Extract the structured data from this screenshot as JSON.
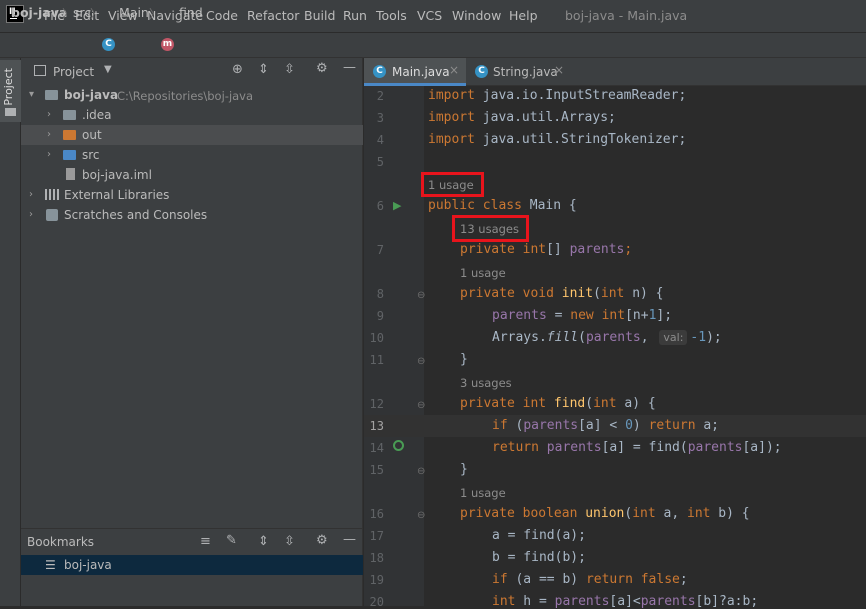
{
  "menubar": {
    "items": [
      "File",
      "Edit",
      "View",
      "Navigate",
      "Code",
      "Refactor",
      "Build",
      "Run",
      "Tools",
      "VCS",
      "Window",
      "Help"
    ],
    "title": "boj-java - Main.java"
  },
  "breadcrumb": {
    "project": "boj-java",
    "folder": "src",
    "class": "Main",
    "method": "find"
  },
  "stripe": {
    "project_label": "Project"
  },
  "project_panel": {
    "title": "Project",
    "root": {
      "name": "boj-java",
      "path": "C:\\Repositories\\boj-java"
    },
    "items": [
      ".idea",
      "out",
      "src",
      "boj-java.iml"
    ],
    "external_libraries": "External Libraries",
    "scratches": "Scratches and Consoles"
  },
  "bookmarks_panel": {
    "title": "Bookmarks",
    "items": [
      "boj-java"
    ]
  },
  "editor": {
    "tabs": [
      "Main.java",
      "String.java"
    ],
    "line_numbers": [
      "2",
      "3",
      "4",
      "5",
      "6",
      "7",
      "8",
      "9",
      "10",
      "11",
      "12",
      "13",
      "14",
      "15",
      "16",
      "17",
      "18",
      "19",
      "20"
    ],
    "hints": {
      "class_usage": "1 usage",
      "parents_usage": "13 usages",
      "init_usage": "1 usage",
      "find_usage": "3 usages",
      "union_usage": "1 usage",
      "param_val": "val:"
    },
    "code": {
      "l2_kw": "import",
      "l2_rest": " java.io.InputStreamReader;",
      "l3_kw": "import",
      "l3_rest": " java.util.Arrays;",
      "l4_kw": "import",
      "l4_rest": " java.util.StringTokenizer;",
      "l6_kw": "public class",
      "l6_rest": " Main {",
      "l7_kw": "private int",
      "l7_br": "[] ",
      "l7_fld": "parents",
      "l7_end": ";",
      "l8_kw": "private void",
      "l8_fn": " init",
      "l8_a": "(",
      "l8_kw2": "int",
      "l8_b": " n) {",
      "l9_fld": "parents",
      "l9_a": " = ",
      "l9_kw": "new int",
      "l9_b": "[n+",
      "l9_num": "1",
      "l9_c": "];",
      "l10_a": "Arrays.",
      "l10_fn": "fill",
      "l10_b": "(",
      "l10_fld": "parents",
      "l10_c": ", ",
      "l10_num": "-1",
      "l10_d": ");",
      "l11": "}",
      "l12_kw": "private int",
      "l12_fn": " find",
      "l12_a": "(",
      "l12_kw2": "int",
      "l12_b": " a) {",
      "l13_kw": "if",
      "l13_a": " (",
      "l13_fld": "parents",
      "l13_b": "[a] < ",
      "l13_num": "0",
      "l13_c": ") ",
      "l13_kw2": "return",
      "l13_d": " a;",
      "l14_kw": "return",
      "l14_sp": " ",
      "l14_fld": "parents",
      "l14_a": "[a] = find(",
      "l14_fld2": "parents",
      "l14_b": "[a]);",
      "l15": "}",
      "l16_kw": "private boolean",
      "l16_fn": " union",
      "l16_a": "(",
      "l16_kw2": "int",
      "l16_b": " a, ",
      "l16_kw3": "int",
      "l16_c": " b) {",
      "l17": "a = find(a);",
      "l18": "b = find(b);",
      "l19_kw": "if",
      "l19_a": " (a == b) ",
      "l19_kw2": "return false",
      "l19_b": ";",
      "l20_kw": "int",
      "l20_a": " h = ",
      "l20_fld": "parents",
      "l20_b": "[a]<",
      "l20_fld2": "parents",
      "l20_c": "[b]?a:b;"
    }
  },
  "colors": {
    "highlight_box": "#e8141c",
    "keyword": "#cc7832",
    "field": "#9876aa",
    "function": "#ffc66d",
    "number": "#6897bb"
  }
}
